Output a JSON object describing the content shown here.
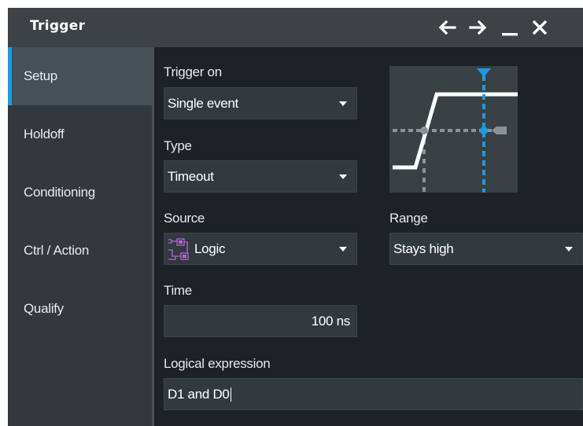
{
  "window": {
    "title": "Trigger",
    "buttons": [
      "back-arrow-icon",
      "forward-arrow-icon",
      "minimize-icon",
      "close-icon"
    ]
  },
  "sidebar": {
    "items": [
      {
        "label": "Setup",
        "active": true
      },
      {
        "label": "Holdoff",
        "active": false
      },
      {
        "label": "Conditioning",
        "active": false
      },
      {
        "label": "Ctrl / Action",
        "active": false
      },
      {
        "label": "Qualify",
        "active": false
      }
    ]
  },
  "form": {
    "trigger_on": {
      "label": "Trigger on",
      "value": "Single event"
    },
    "type": {
      "label": "Type",
      "value": "Timeout"
    },
    "source": {
      "label": "Source",
      "value": "Logic",
      "icon": "logic-source-icon"
    },
    "range": {
      "label": "Range",
      "value": "Stays high"
    },
    "time": {
      "label": "Time",
      "value": "100 ns"
    },
    "logical_expression": {
      "label": "Logical expression",
      "value": "D1 and D0"
    }
  },
  "preview": {
    "icon": "timeout-trigger-diagram"
  },
  "colors": {
    "accent": "#1b9ae4",
    "background": "#1e2226",
    "titlebar": "#3c4246",
    "sidebar": "#33383c",
    "field": "#333a3f",
    "logic_icon": "#b267d6"
  }
}
